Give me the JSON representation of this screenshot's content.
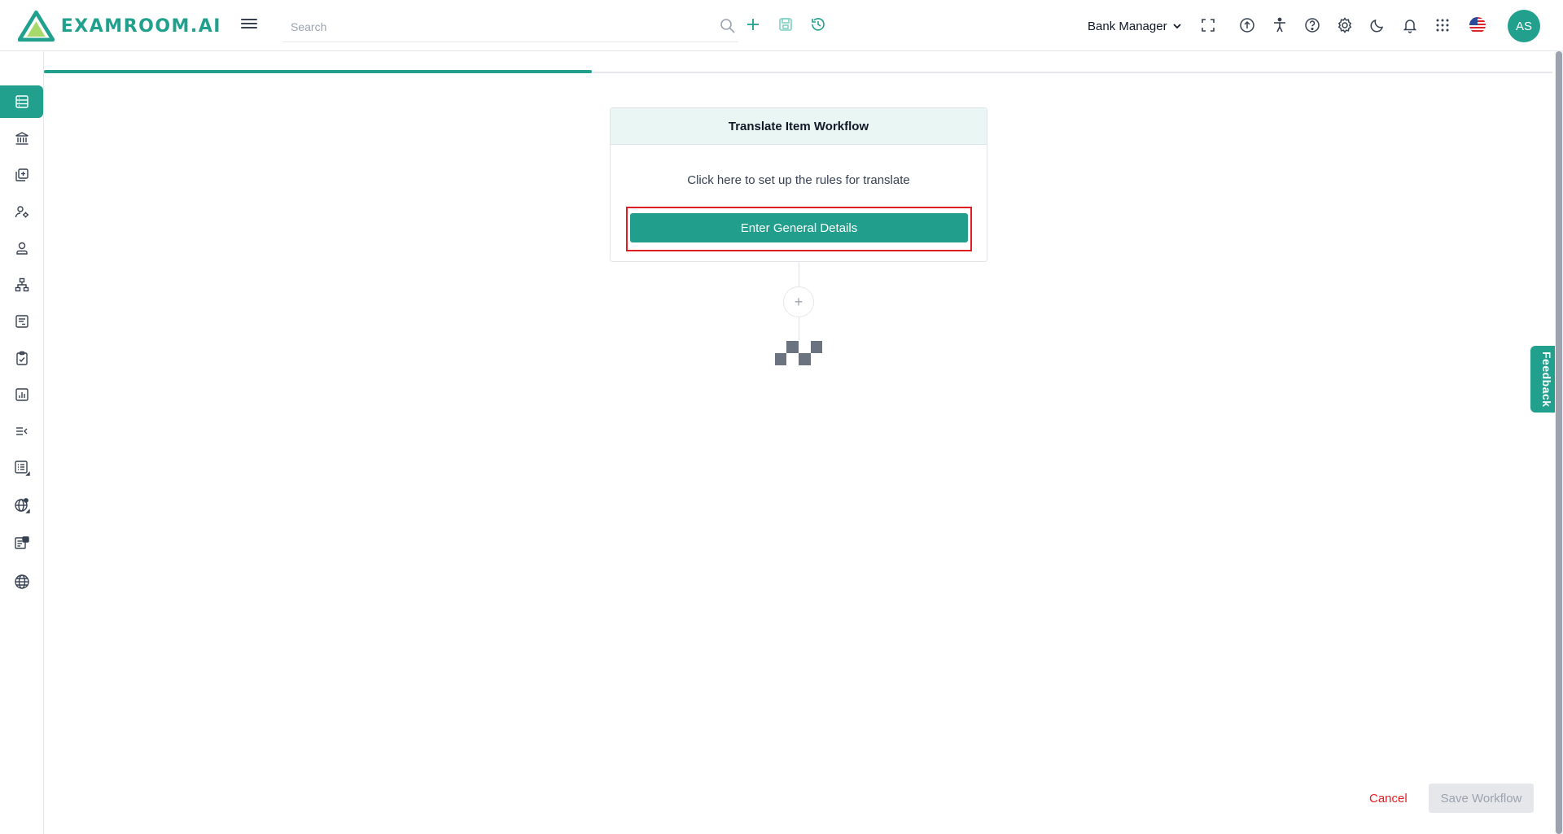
{
  "app": {
    "logo_text": "EXAMROOM.AI",
    "brand_color": "#22a08e"
  },
  "header": {
    "search_placeholder": "Search",
    "role": "Bank Manager",
    "avatar_initials": "AS",
    "actions": [
      "add-icon",
      "save-icon",
      "history-icon"
    ],
    "icons": [
      "fullscreen-icon",
      "upload-icon",
      "accessibility-icon",
      "help-icon",
      "settings-icon",
      "dark-mode-icon",
      "notifications-icon",
      "apps-grid-icon",
      "us-flag-icon"
    ]
  },
  "sidebar": {
    "items": [
      {
        "icon": "dashboard-icon",
        "active": true
      },
      {
        "icon": "bank-icon"
      },
      {
        "icon": "add-item-icon"
      },
      {
        "icon": "user-settings-icon"
      },
      {
        "icon": "user-icon"
      },
      {
        "icon": "hierarchy-icon"
      },
      {
        "icon": "document-icon"
      },
      {
        "icon": "clipboard-check-icon"
      },
      {
        "icon": "bar-chart-icon"
      },
      {
        "icon": "list-collapse-icon"
      },
      {
        "icon": "list-icon"
      },
      {
        "icon": "globe-settings-icon"
      },
      {
        "icon": "translation-icon"
      },
      {
        "icon": "globe-icon"
      }
    ]
  },
  "progress": {
    "percent": 36.3
  },
  "workflow": {
    "title": "Translate Item Workflow",
    "description": "Click here to set up the rules for translate",
    "button_label": "Enter General Details",
    "add_step_label": "+"
  },
  "feedback_label": "Feedback",
  "footer": {
    "cancel_label": "Cancel",
    "save_label": "Save Workflow"
  }
}
